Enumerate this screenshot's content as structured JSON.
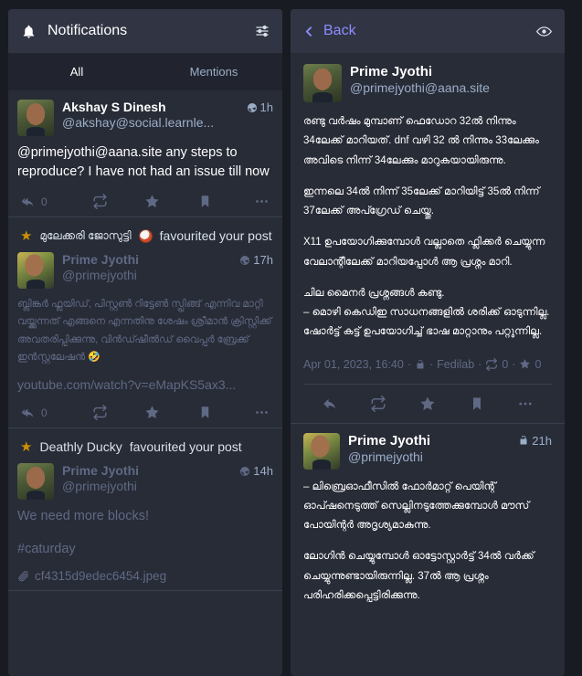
{
  "notifications_column": {
    "header": {
      "title": "Notifications",
      "bell_icon": "bell-icon",
      "settings_icon": "sliders-icon"
    },
    "tabs": [
      {
        "label": "All",
        "active": true
      },
      {
        "label": "Mentions",
        "active": false
      }
    ],
    "items": [
      {
        "type": "mention",
        "account": {
          "display_name": "Akshay S Dinesh",
          "handle": "@akshay@social.learnle..."
        },
        "visibility_icon": "globe-icon",
        "time": "1h",
        "body": "@primejyothi@aana.site any steps to reproduce? I have not had an issue till now",
        "actions": {
          "reply_icon": "reply-all-icon",
          "reply_count": "0",
          "boost_icon": "boost-icon",
          "favourite_icon": "star-icon",
          "bookmark_icon": "bookmark-icon",
          "more_icon": "ellipsis-icon"
        }
      },
      {
        "type": "favourite",
        "header": {
          "star_icon": "star-icon",
          "actor_name": "മുലേക്കരി ജോസുട്ടി",
          "actor_emoji": "custom-emoji",
          "text": "favourited your post"
        },
        "account": {
          "display_name": "Prime Jyothi",
          "handle": "@primejyothi"
        },
        "visibility_icon": "globe-icon",
        "time": "17h",
        "body_lines": [
          "ബ്ലിങ്കർ ഫ്ലയിഡ്, പിസ്റ്റൺ റിട്ടേൺ സ്പ്രിങ്ങ് എന്നിവ മാറ്റി വയ്ക്കുന്നത് എങ്ങനെ എന്നതിനു ശേഷം ശ്രീമാൻ ക്രിസ്റ്റിക്ക് അവതരിപ്പിക്കുന്നു, വിൻഡ്ഷീൽഡ് വൈപ്പർ ബ്രേക്ക് ഇൻസ്റ്റലേഷൻ 🤣"
        ],
        "link": "youtube.com/watch?v=eMapKS5ax3...",
        "actions": {
          "reply_icon": "reply-all-icon",
          "reply_count": "0",
          "boost_icon": "boost-icon",
          "favourite_icon": "star-icon",
          "bookmark_icon": "bookmark-icon",
          "more_icon": "ellipsis-icon"
        }
      },
      {
        "type": "favourite",
        "header": {
          "star_icon": "star-icon",
          "actor_name": "Deathly Ducky",
          "text": "favourited your post"
        },
        "account": {
          "display_name": "Prime Jyothi",
          "handle": "@primejyothi"
        },
        "visibility_icon": "globe-icon",
        "time": "14h",
        "body_line_1": "We need more blocks!",
        "body_line_2": "#caturday",
        "attachment_icon": "paperclip-icon",
        "attachment": "cf4315d9edec6454.jpeg"
      }
    ]
  },
  "detail_column": {
    "header": {
      "back_icon": "chevron-left-icon",
      "back_label": "Back",
      "eye_icon": "eye-icon"
    },
    "status": {
      "account": {
        "display_name": "Prime Jyothi",
        "handle": "@primejyothi@aana.site"
      },
      "paragraphs": [
        "രണ്ടു വർഷം മുമ്പാണ് ഫെഡോറ 32ൽ നിന്നും 34ലേക്ക് മാറിയത്. dnf വഴി 32 ൽ നിന്നും 33ലേക്കും അവിടെ നിന്ന് 34ലേക്കും മാറുകയായിരുന്നു.",
        "ഇന്നലെ 34ൽ നിന്ന് 35ലേക്ക് മാറിയിട്ട് 35ൽ നിന്ന് 37ലേക്ക് അപ്ഗ്രേഡ് ചെയ്തു.",
        " X11 ഉപയോഗിക്കുമ്പോൾ വല്ലാതെ ഫ്ലിക്കർ ചെയ്യുന്ന വേലാന്റീലേക്ക് മാറിയപ്പോൾ ആ പ്രശ്നം മാറി.",
        "ചില മൈനർ പ്രശ്നങ്ങൾ കണ്ടു.\n– മൊഴി കെഡിഇ സാധനങ്ങളിൽ ശരിക്ക് ഓടുന്നില്ല. ഷോർട്ട് കട്ട് ഉപയോഗിച്ച് ഭാഷ മാറ്റാനും പറ്റുന്നില്ല."
      ],
      "meta": {
        "timestamp": "Apr 01, 2023, 16:40",
        "visibility_icon": "unlock-icon",
        "app": "Fedilab",
        "boost_icon": "boost-icon",
        "boost_count": "0",
        "favourite_icon": "star-icon",
        "favourite_count": "0"
      },
      "actions": {
        "reply_icon": "reply-icon",
        "boost_icon": "boost-icon",
        "favourite_icon": "star-icon",
        "bookmark_icon": "bookmark-icon",
        "more_icon": "ellipsis-icon"
      }
    },
    "reply": {
      "account": {
        "display_name": "Prime Jyothi",
        "handle": "@primejyothi"
      },
      "visibility_icon": "unlock-icon",
      "time": "21h",
      "paragraphs": [
        "– ലിബ്രെഓഫീസിൽ ഫോർമാറ്റ് പെയിന്റ് ഓപ്ഷനെടുത്ത് സെല്ലിനടുത്തേക്കുമ്പോൾ മൗസ് പോയിന്റർ അദൃശ്യമാകുന്നു.",
        "ലോഗിൻ ചെയ്യുമ്പോൾ ഓട്ടോസ്റ്റാർട്ട് 34ൽ വർക്ക് ചെയ്യുന്നുണ്ടായിരുന്നില്ല. 37ൽ ആ പ്രശ്നം പരിഹരിക്കപ്പെട്ടിരിക്കുന്നു."
      ]
    }
  },
  "colors": {
    "background": "#191b22",
    "panel": "#282c37",
    "panel_header": "#313543",
    "tabs_bar": "#21242e",
    "text_primary": "#ffffff",
    "text_secondary": "#9baec8",
    "text_muted": "#606984",
    "accent": "#8c8dff",
    "star_gold": "#ca8f04",
    "divider": "#393f4f"
  }
}
